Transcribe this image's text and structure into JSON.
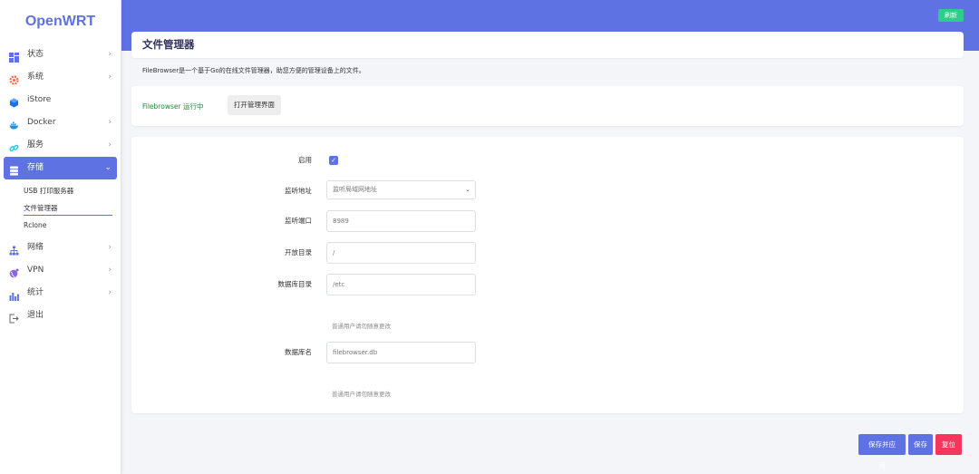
{
  "brand": "OpenWRT",
  "header": {
    "refresh_label": "刷新"
  },
  "sidebar": {
    "items": [
      {
        "label": "状态",
        "icon": "dashboard-icon",
        "chevron": "›"
      },
      {
        "label": "系统",
        "icon": "gear-icon",
        "chevron": "›"
      },
      {
        "label": "iStore",
        "icon": "box-icon",
        "chevron": ""
      },
      {
        "label": "Docker",
        "icon": "docker-icon",
        "chevron": "›"
      },
      {
        "label": "服务",
        "icon": "link-icon",
        "chevron": "›"
      },
      {
        "label": "存储",
        "icon": "database-icon",
        "chevron": "⌄"
      },
      {
        "label": "网络",
        "icon": "network-icon",
        "chevron": "›"
      },
      {
        "label": "VPN",
        "icon": "globe-icon",
        "chevron": "›"
      },
      {
        "label": "统计",
        "icon": "chart-icon",
        "chevron": "›"
      },
      {
        "label": "退出",
        "icon": "logout-icon",
        "chevron": ""
      }
    ],
    "storage_sub": [
      "USB 打印服务器",
      "文件管理器",
      "Rclone"
    ]
  },
  "page": {
    "title": "文件管理器",
    "description": "FileBrowser是一个基于Go的在线文件管理器，助您方便的管理设备上的文件。",
    "status_text": "Filebrowser 运行中",
    "open_button": "打开管理界面"
  },
  "form": {
    "enable_label": "启用",
    "enabled": true,
    "listen_addr_label": "监听地址",
    "listen_addr_value": "监听局域网地址",
    "listen_port_label": "监听端口",
    "listen_port_value": "8989",
    "root_dir_label": "开放目录",
    "root_dir_value": "/",
    "db_dir_label": "数据库目录",
    "db_dir_value": "/etc",
    "db_dir_hint": "普通用户请勿随意更改",
    "db_name_label": "数据库名",
    "db_name_value": "filebrowser.db",
    "db_name_hint": "普通用户请勿随意更改"
  },
  "actions": {
    "save_apply": "保存并应用",
    "save": "保存",
    "reset": "复位"
  },
  "colors": {
    "primary": "#5e72e4",
    "success": "#2dce89",
    "danger": "#f5365c",
    "running": "#198d2d"
  }
}
